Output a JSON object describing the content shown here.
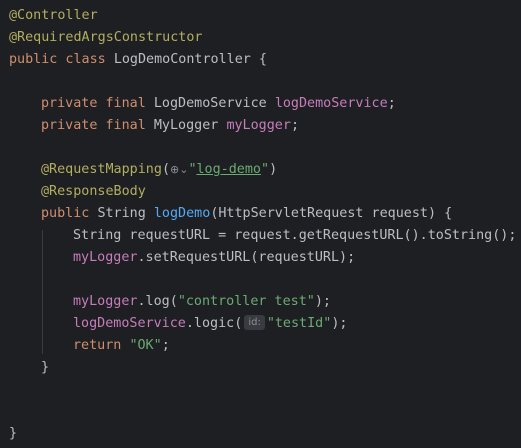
{
  "code": {
    "l1_annotation": "@Controller",
    "l2_annotation": "@RequiredArgsConstructor",
    "l3_kw": "public class ",
    "l3_classname": "LogDemoController {",
    "l5_kw": "private final ",
    "l5_type": "LogDemoService ",
    "l5_field": "logDemoService",
    "l5_end": ";",
    "l6_kw": "private final ",
    "l6_type": "MyLogger ",
    "l6_field": "myLogger",
    "l6_end": ";",
    "l8_annotation": "@RequestMapping",
    "l8_open": "(",
    "l8_globe": "⊕⌄",
    "l8_q1": "\"",
    "l8_path": "log-demo",
    "l8_q2": "\"",
    "l8_close": ")",
    "l9_annotation": "@ResponseBody",
    "l10_kw": "public ",
    "l10_type": "String ",
    "l10_method": "logDemo",
    "l10_params": "(HttpServletRequest request) {",
    "l11_text": "String requestURL = request.getRequestURL().toString();",
    "l12_field": "myLogger",
    "l12_rest": ".setRequestURL(requestURL);",
    "l14_field": "myLogger",
    "l14_mid": ".log(",
    "l14_str": "\"controller test\"",
    "l14_end": ");",
    "l15_field": "logDemoService",
    "l15_mid": ".logic(",
    "l15_hint": "id:",
    "l15_str": "\"testId\"",
    "l15_end": ");",
    "l16_kw": "return ",
    "l16_str": "\"OK\"",
    "l16_end": ";",
    "l17_brace": "}",
    "l20_brace": "}"
  },
  "colors": {
    "background": "#1e1f22",
    "annotation": "#b3ae60",
    "keyword": "#cf8e6d",
    "field": "#c77dbb",
    "method": "#56a8f5",
    "string": "#6aab73",
    "text": "#bcbec4"
  },
  "icons": {
    "globe": "globe-icon"
  }
}
